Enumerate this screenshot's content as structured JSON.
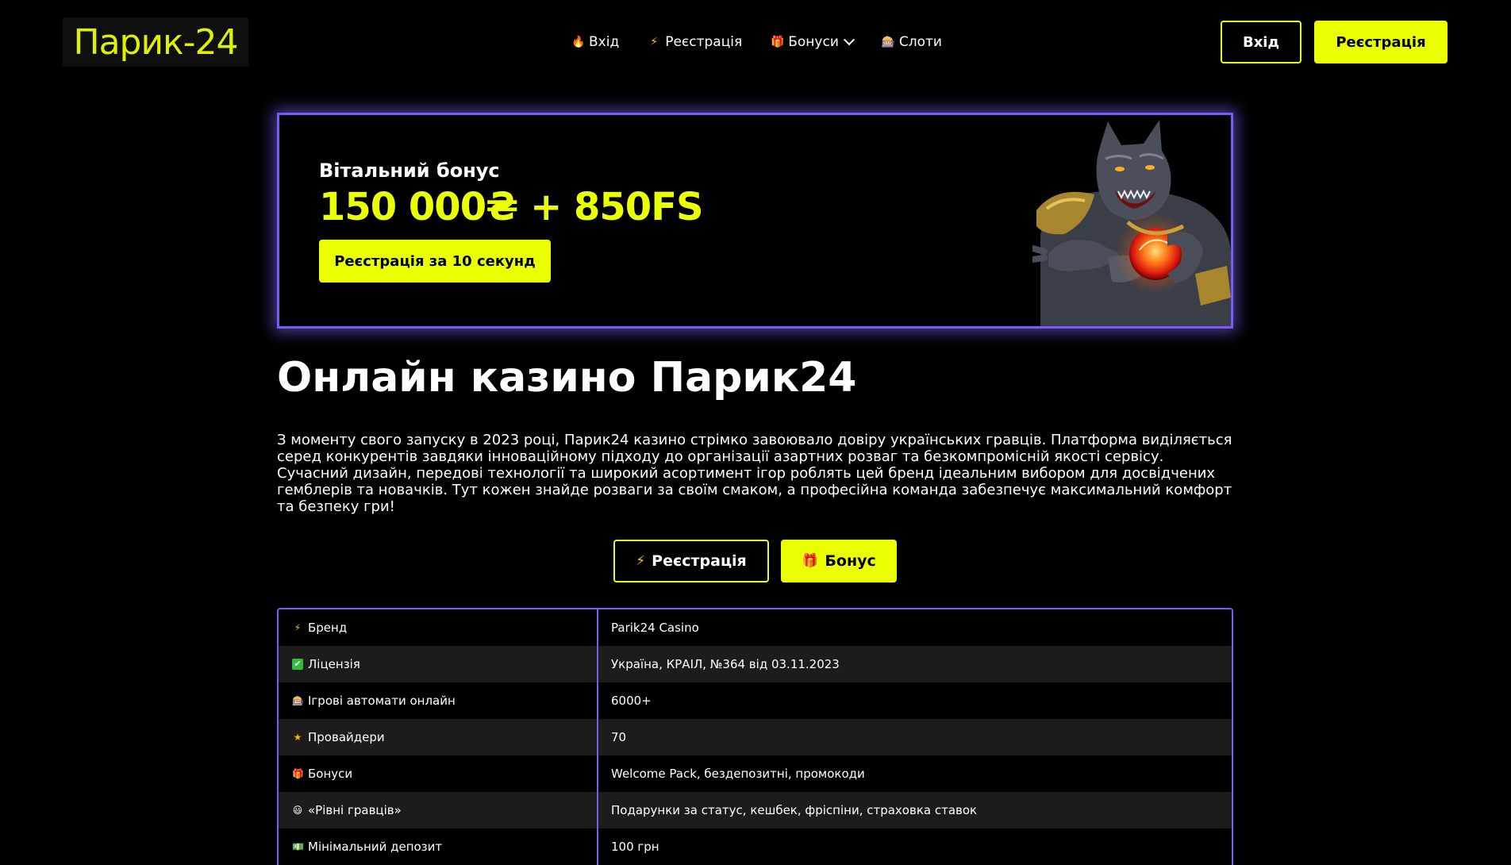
{
  "header": {
    "logo": "Парик-24",
    "nav": [
      {
        "label": "Вхід",
        "icon": "fire-icon",
        "glyph": "🔥"
      },
      {
        "label": "Реєстрація",
        "icon": "lightning-icon",
        "glyph": "⚡"
      },
      {
        "label": "Бонуси",
        "icon": "gift-icon",
        "glyph": "🎁"
      },
      {
        "label": "Слоти",
        "icon": "slot-machine-icon",
        "glyph": "🎰"
      }
    ],
    "login_label": "Вхід",
    "register_label": "Реєстрація"
  },
  "banner": {
    "subtitle": "Вітальний бонус",
    "amount": "150 000₴ + 850FS",
    "button_label": "Реєстрація за 10 секунд"
  },
  "main": {
    "title": "Онлайн казино Парик24",
    "intro": "З моменту свого запуску в 2023 році, Парик24 казино стрімко завоювало довіру українських гравців. Платформа виділяється серед конкурентів завдяки інноваційному підходу до організації азартних розваг та безкомпромісній якості сервісу. Сучасний дизайн, передові технології та широкий асортимент ігор роблять цей бренд ідеальним вибором для досвідчених гемблерів та новачків. Тут кожен знайде розваги за своїм смаком, а професійна команда забезпечує максимальний комфорт та безпеку гри!",
    "cta_register": "Реєстрація",
    "cta_bonus": "Бонус"
  },
  "table": {
    "rows": [
      {
        "key": "Бренд",
        "value": "Parik24 Casino",
        "icon": "lightning-icon",
        "glyph": "⚡"
      },
      {
        "key": "Ліцензія",
        "value": "Україна, КРАІЛ, №364 від 03.11.2023",
        "icon": "check-icon",
        "glyph": "✔"
      },
      {
        "key": "Ігрові автомати онлайн",
        "value": "6000+",
        "icon": "slot-machine-icon",
        "glyph": "🎰"
      },
      {
        "key": "Провайдери",
        "value": "70",
        "icon": "star-icon",
        "glyph": "★"
      },
      {
        "key": "Бонуси",
        "value": "Welcome Pack, бездепозитні, промокоди",
        "icon": "gift-icon",
        "glyph": "🎁"
      },
      {
        "key": "«Рівні гравців»",
        "value": "Подарунки за статус, кешбек, фріспіни, страховка ставок",
        "icon": "smiley-icon",
        "glyph": "😃"
      },
      {
        "key": "Мінімальний депозит",
        "value": "100 грн",
        "icon": "money-icon",
        "glyph": "💵"
      }
    ]
  },
  "colors": {
    "accent": "#eaff00",
    "border": "#7a5cf2",
    "background": "#000000"
  }
}
